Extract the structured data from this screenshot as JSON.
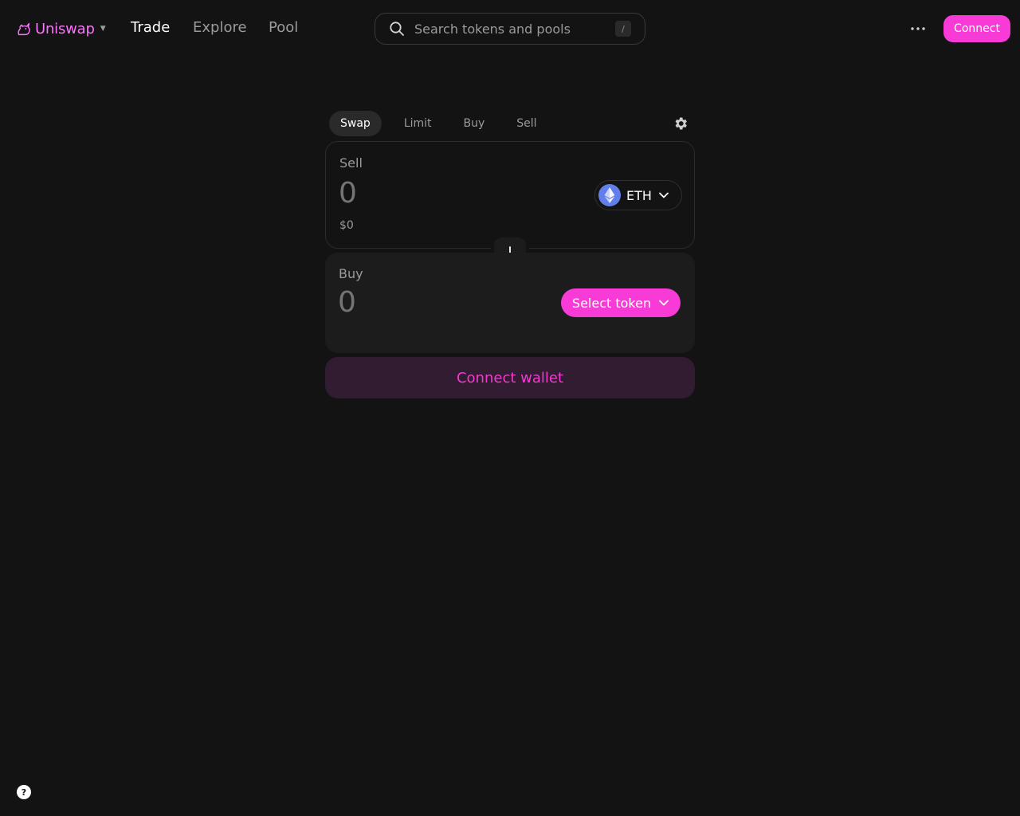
{
  "header": {
    "brand": "Uniswap",
    "nav": [
      {
        "label": "Trade",
        "active": true
      },
      {
        "label": "Explore",
        "active": false
      },
      {
        "label": "Pool",
        "active": false
      }
    ],
    "search": {
      "placeholder": "Search tokens and pools",
      "shortcut": "/"
    },
    "connect_label": "Connect"
  },
  "swap": {
    "tabs": [
      {
        "label": "Swap",
        "active": true
      },
      {
        "label": "Limit",
        "active": false
      },
      {
        "label": "Buy",
        "active": false
      },
      {
        "label": "Sell",
        "active": false
      }
    ],
    "sell": {
      "label": "Sell",
      "amount": "0",
      "usd_value": "$0",
      "token": "ETH"
    },
    "buy": {
      "label": "Buy",
      "amount": "0",
      "select_label": "Select token"
    },
    "connect_wallet_label": "Connect wallet"
  },
  "help": {
    "label": "?"
  },
  "icons": {
    "logo": "uniswap-unicorn-icon",
    "search": "search-icon",
    "more": "more-horizontal-icon",
    "settings": "gear-icon",
    "token": "eth-icon",
    "chevron": "chevron-down-icon",
    "flip": "arrow-down-icon"
  },
  "colors": {
    "background": "#131313",
    "accent": "#FC72FF",
    "primary_button": "#f83bd6",
    "eth": "#627EEA"
  }
}
